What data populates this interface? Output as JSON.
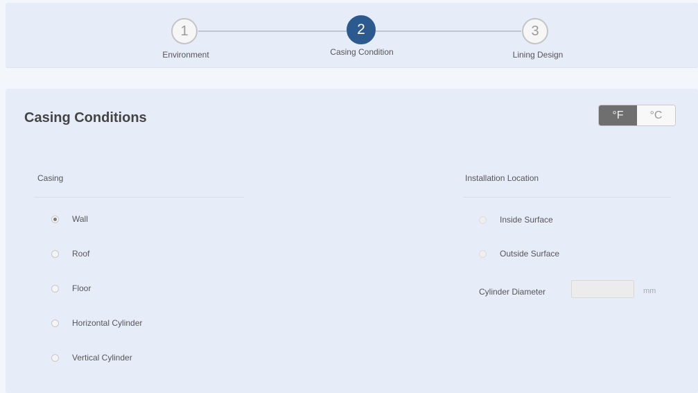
{
  "stepper": {
    "steps": [
      {
        "number": "1",
        "label": "Environment",
        "state": "inactive"
      },
      {
        "number": "2",
        "label": "Casing Condition",
        "state": "active"
      },
      {
        "number": "3",
        "label": "Lining Design",
        "state": "inactive"
      }
    ]
  },
  "page": {
    "title": "Casing Conditions"
  },
  "units": {
    "fahrenheit": "°F",
    "celsius": "°C",
    "selected": "fahrenheit"
  },
  "casing": {
    "label": "Casing",
    "options": [
      {
        "label": "Wall",
        "checked": true
      },
      {
        "label": "Roof",
        "checked": false
      },
      {
        "label": "Floor",
        "checked": false
      },
      {
        "label": "Horizontal Cylinder",
        "checked": false
      },
      {
        "label": "Vertical Cylinder",
        "checked": false
      }
    ]
  },
  "installation": {
    "label": "Installation Location",
    "options": [
      {
        "label": "Inside Surface",
        "checked": false,
        "disabled": true
      },
      {
        "label": "Outside Surface",
        "checked": false,
        "disabled": true
      }
    ]
  },
  "cylinder_diameter": {
    "label": "Cylinder Diameter",
    "value": "",
    "unit": "mm"
  },
  "colors": {
    "active_step": "#2d5a8e",
    "panel_bg": "#e6edf9",
    "toggle_active": "#6f6f6f"
  }
}
